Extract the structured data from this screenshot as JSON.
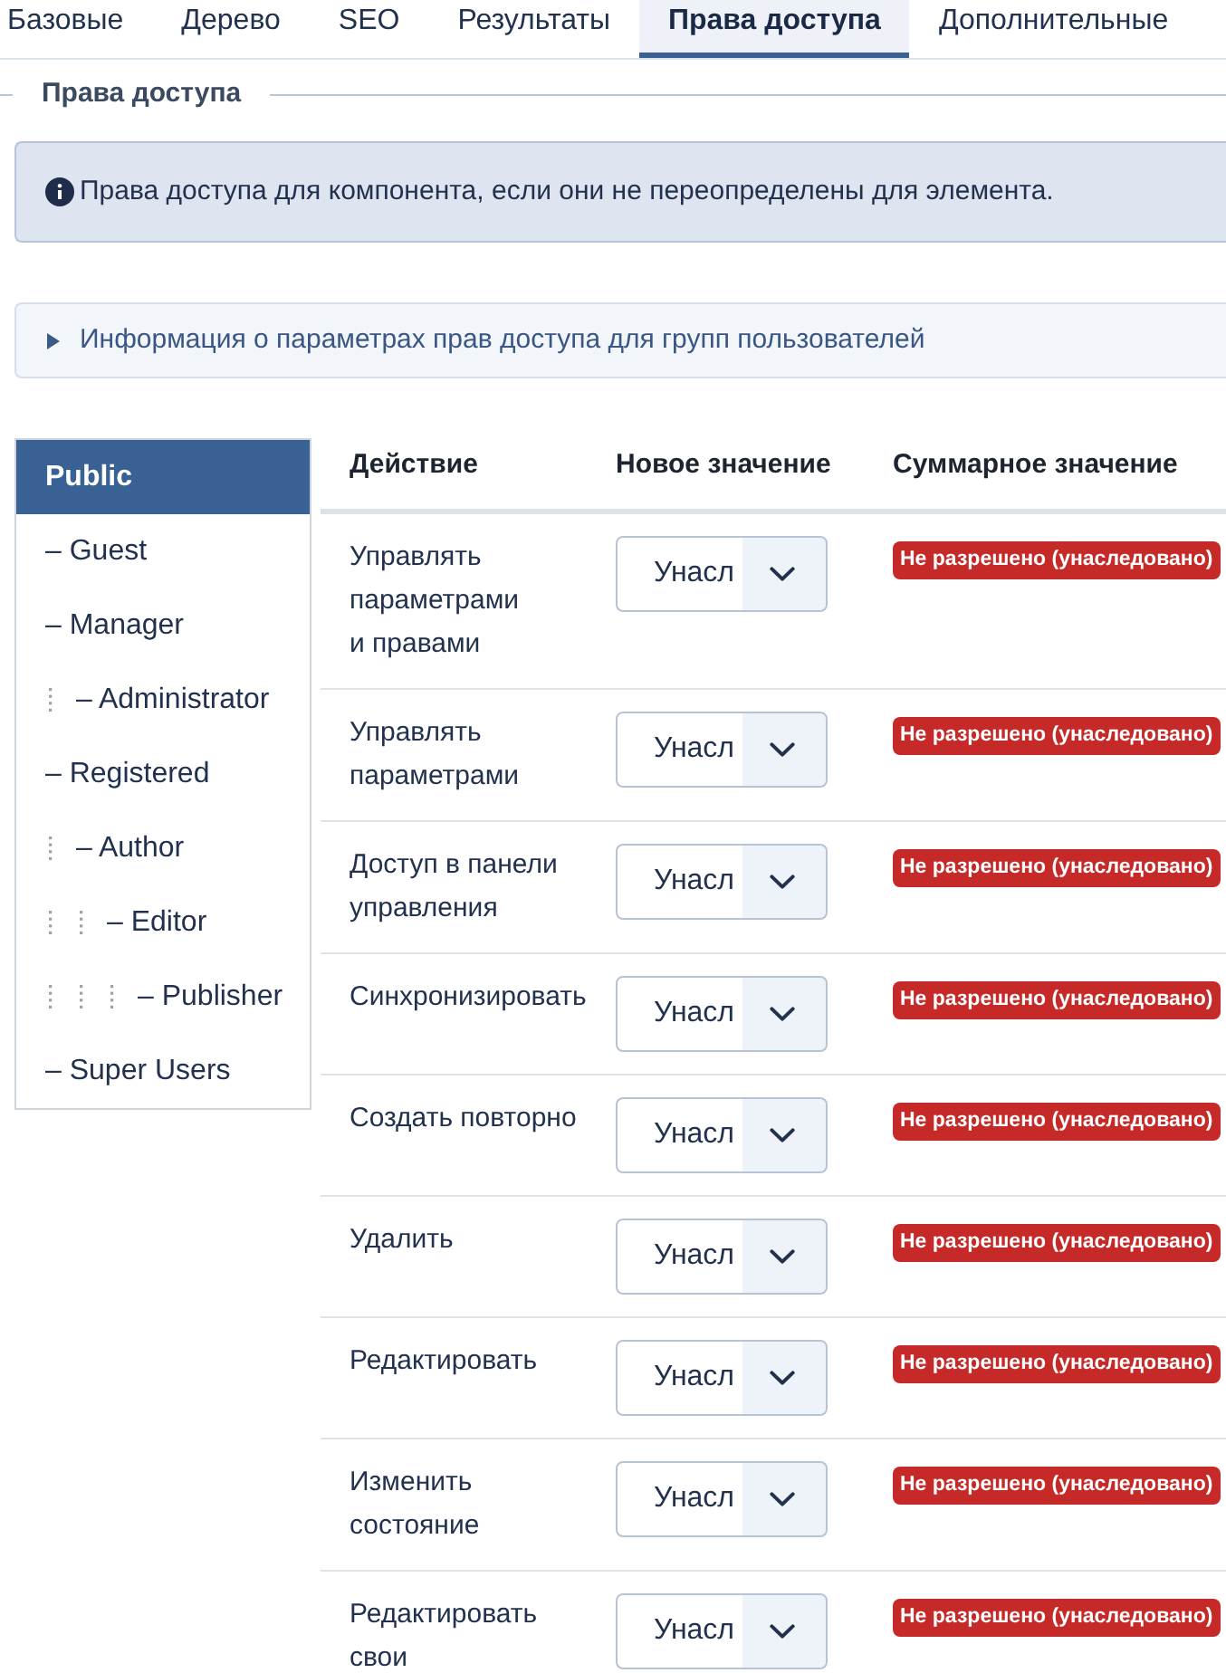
{
  "tabs": [
    {
      "label": "Базовые",
      "selected": false
    },
    {
      "label": "Дерево",
      "selected": false
    },
    {
      "label": "SEO",
      "selected": false
    },
    {
      "label": "Результаты",
      "selected": false
    },
    {
      "label": "Права доступа",
      "selected": true
    },
    {
      "label": "Дополнительные",
      "selected": false
    }
  ],
  "fieldset": {
    "legend": "Права доступа"
  },
  "info_alert": {
    "text": "Права доступа для компонента, если они не переопределены для элемента."
  },
  "details": {
    "summary": "Информация о параметрах прав доступа для групп пользователей",
    "expanded": false
  },
  "groups": [
    {
      "label": "Public",
      "selected": true,
      "children": [
        {
          "label": "– Guest",
          "selected": false
        },
        {
          "label": "– Manager",
          "selected": false,
          "children": [
            {
              "label": "– Administrator",
              "selected": false
            }
          ]
        },
        {
          "label": "– Registered",
          "selected": false,
          "children": [
            {
              "label": "– Author",
              "selected": false,
              "children": [
                {
                  "label": "– Editor",
                  "selected": false,
                  "children": [
                    {
                      "label": "– Publisher",
                      "selected": false
                    }
                  ]
                }
              ]
            }
          ]
        },
        {
          "label": "– Super Users",
          "selected": false
        }
      ]
    }
  ],
  "permissions": {
    "columns": [
      "Действие",
      "Новое значение",
      "Суммарное значение"
    ],
    "rows": [
      {
        "action": "Управлять параметрами и правами",
        "new_value": "Унасл",
        "calculated_value": "Не разрешено (унаследовано)"
      },
      {
        "action": "Управлять параметрами",
        "new_value": "Унасл",
        "calculated_value": "Не разрешено (унаследовано)"
      },
      {
        "action": "Доступ в панели управления",
        "new_value": "Унасл",
        "calculated_value": "Не разрешено (унаследовано)"
      },
      {
        "action": "Синхронизировать",
        "new_value": "Унасл",
        "calculated_value": "Не разрешено (унаследовано)"
      },
      {
        "action": "Создать повторно",
        "new_value": "Унасл",
        "calculated_value": "Не разрешено (унаследовано)"
      },
      {
        "action": "Удалить",
        "new_value": "Унасл",
        "calculated_value": "Не разрешено (унаследовано)"
      },
      {
        "action": "Редактировать",
        "new_value": "Унасл",
        "calculated_value": "Не разрешено (унаследовано)"
      },
      {
        "action": "Изменить состояние",
        "new_value": "Унасл",
        "calculated_value": "Не разрешено (унаследовано)"
      },
      {
        "action": "Редактировать свои",
        "new_value": "Унасл",
        "calculated_value": "Не разрешено (унаследовано)"
      }
    ]
  }
}
